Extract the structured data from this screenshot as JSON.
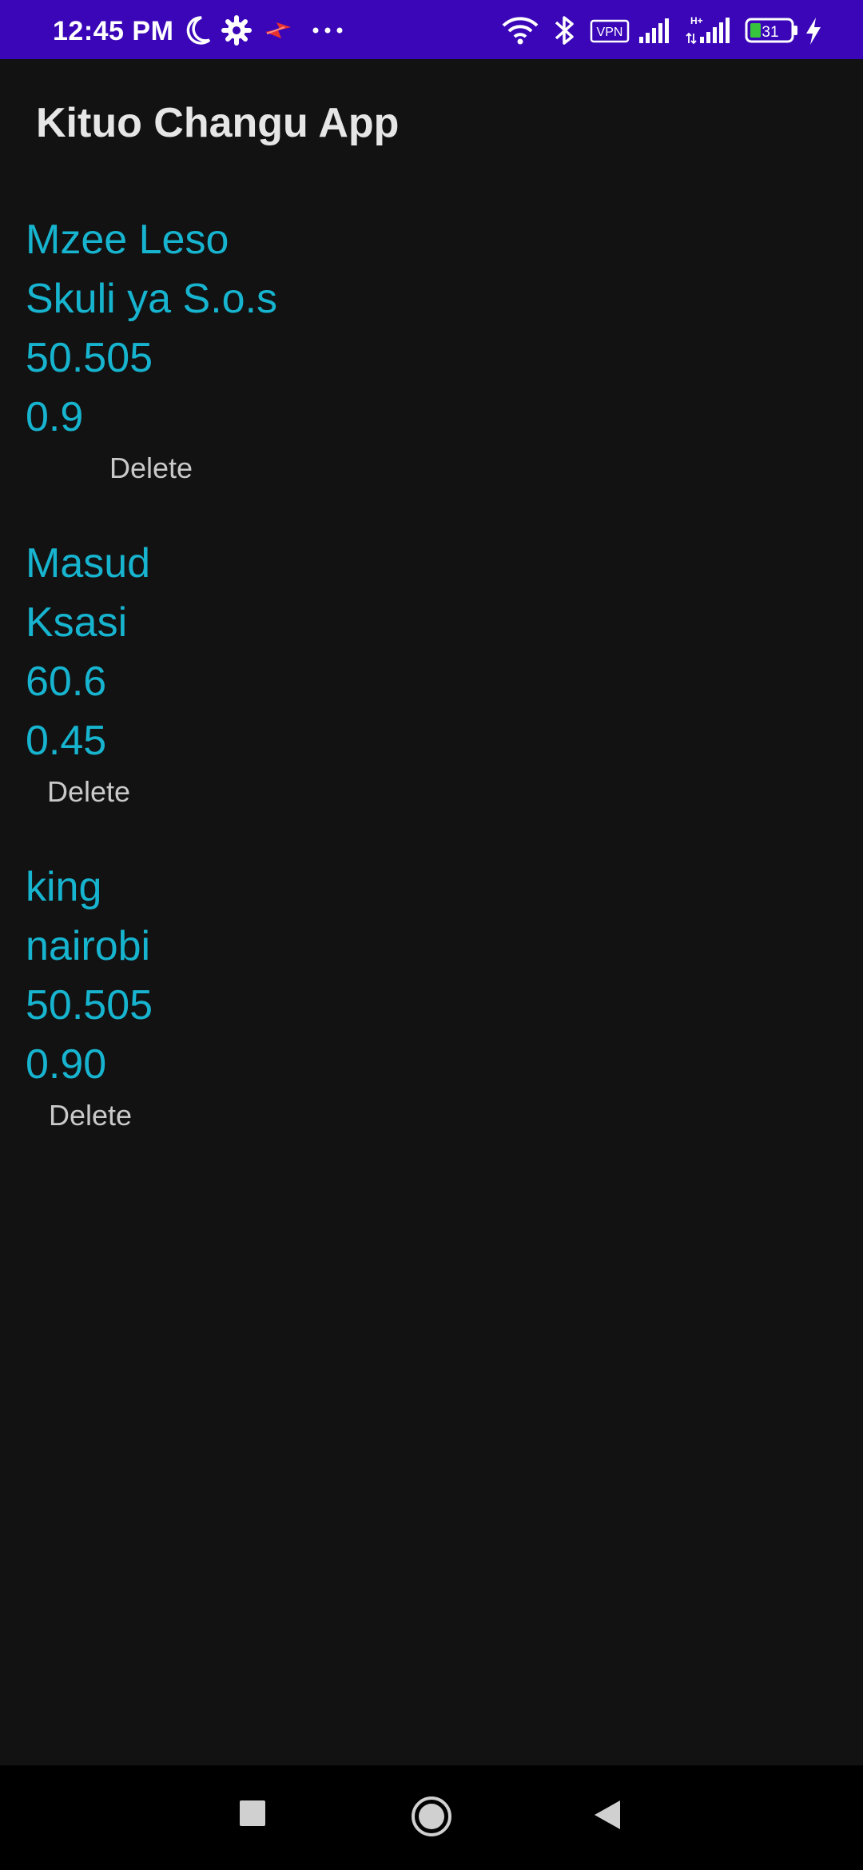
{
  "status_bar": {
    "time": "12:45 PM",
    "vpn_label": "VPN",
    "battery_level": "31",
    "network_type": "H+"
  },
  "app": {
    "title": "Kituo Changu App"
  },
  "entries": [
    {
      "name": "Mzee Leso",
      "location": "Skuli ya S.o.s",
      "value_one": "50.505",
      "value_two": "0.9",
      "delete_label": "Delete"
    },
    {
      "name": "Masud",
      "location": "Ksasi",
      "value_one": "60.6",
      "value_two": "0.45",
      "delete_label": "Delete"
    },
    {
      "name": "king",
      "location": "nairobi",
      "value_one": "50.505",
      "value_two": "0.90",
      "delete_label": "Delete"
    }
  ],
  "colors": {
    "status_bar": "#3a06b8",
    "background": "#121212",
    "entry_text": "#17b4cf",
    "delete_text": "#c9c9c9",
    "nav_bar": "#000000"
  },
  "icons": {
    "status": [
      "moon-icon",
      "gear-icon",
      "flash-app-icon",
      "more-dots-icon",
      "wifi-icon",
      "bluetooth-icon",
      "vpn-icon",
      "signal-icon",
      "signal-h-plus-icon",
      "battery-icon",
      "charging-icon"
    ],
    "nav": [
      "recents-square-icon",
      "home-circle-icon",
      "back-triangle-icon"
    ]
  }
}
